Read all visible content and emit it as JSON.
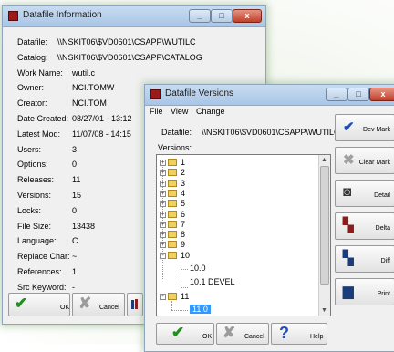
{
  "info_window": {
    "title": "Datafile Information",
    "fields": [
      {
        "label": "Datafile:",
        "value": "\\\\NSKIT06\\$VD0601\\CSAPP\\WUTILC"
      },
      {
        "label": "Catalog:",
        "value": "\\\\NSKIT06\\$VD0601\\CSAPP\\CATALOG"
      },
      {
        "label": "Work Name:",
        "value": "wutil.c"
      },
      {
        "label": "Owner:",
        "value": "NCI.TOMW"
      },
      {
        "label": "Creator:",
        "value": "NCI.TOM"
      },
      {
        "label": "Date Created:",
        "value": "08/27/01 - 13:12"
      },
      {
        "label": "Latest Mod:",
        "value": "11/07/08 - 14:15"
      },
      {
        "label": "Users:",
        "value": "3"
      },
      {
        "label": "Options:",
        "value": "0"
      },
      {
        "label": "Releases:",
        "value": "11"
      },
      {
        "label": "Versions:",
        "value": "15"
      },
      {
        "label": "Locks:",
        "value": "0"
      },
      {
        "label": "File Size:",
        "value": "13438"
      },
      {
        "label": "Language:",
        "value": "C"
      },
      {
        "label": "Replace Char:",
        "value": "~"
      },
      {
        "label": "References:",
        "value": "1"
      },
      {
        "label": "Src Keyword:",
        "value": "-"
      },
      {
        "label": "File Code:",
        "value": ""
      }
    ],
    "ok_label": "OK",
    "cancel_label": "Cancel"
  },
  "versions_window": {
    "title": "Datafile Versions",
    "menu": [
      "File",
      "View",
      "Change"
    ],
    "datafile_label": "Datafile:",
    "datafile_value": "\\\\NSKIT06\\$VD0601\\CSAPP\\WUTILC",
    "versions_label": "Versions:",
    "tree": [
      "1",
      "2",
      "3",
      "4",
      "5",
      "6",
      "7",
      "8",
      "9",
      "10"
    ],
    "release_10_children": [
      "10.0",
      "10.1  DEVEL"
    ],
    "release_11": "11",
    "release_11_children": [
      "11.0"
    ],
    "side_buttons": [
      "Dev Mark",
      "Clear Mark",
      "Detail",
      "Delta",
      "Diff",
      "Print"
    ],
    "ok_label": "OK",
    "cancel_label": "Cancel",
    "help_label": "Help"
  }
}
